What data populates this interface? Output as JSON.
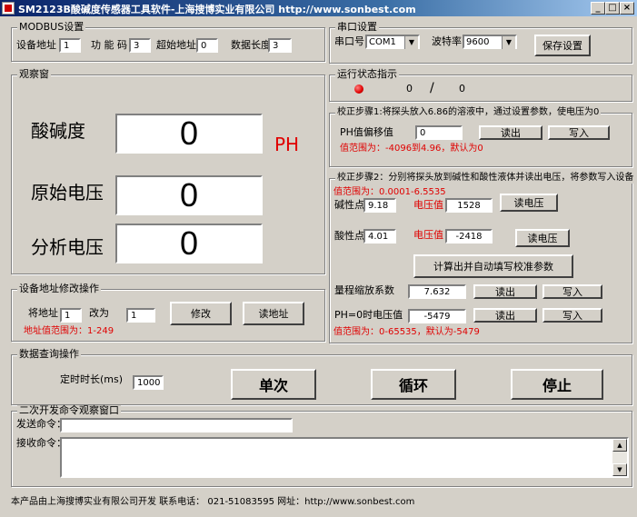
{
  "window": {
    "title": "SM2123B酸碱度传感器工具软件-上海搜博实业有限公司 http://www.sonbest.com"
  },
  "modbus": {
    "title": "MODBUS设置",
    "addr_label": "设备地址",
    "addr_value": "1",
    "func_label": "功 能 码",
    "func_value": "3",
    "start_label": "超始地址",
    "start_value": "0",
    "len_label": "数据长度",
    "len_value": "3"
  },
  "serial": {
    "title": "串口设置",
    "port_label": "串口号",
    "port_value": "COM1",
    "baud_label": "波特率",
    "baud_value": "9600",
    "save_label": "保存设置"
  },
  "status": {
    "title": "运行状态指示",
    "count_a": "0",
    "sep": "/",
    "count_b": "0"
  },
  "observe": {
    "title": "观察窗",
    "ph_label": "酸碱度",
    "ph_value": "0",
    "ph_unit": "PH",
    "raw_label": "原始电压",
    "raw_value": "0",
    "ana_label": "分析电压",
    "ana_value": "0"
  },
  "calib1": {
    "title": "校正步骤1:将探头放入6.86的溶液中，通过设置参数，使电压为0",
    "offset_label": "PH值偏移值",
    "offset_value": "0",
    "read_label": "读出",
    "write_label": "写入",
    "range_note": "值范围为：-4096到4.96，默认为0"
  },
  "calib2": {
    "title": "校正步骤2：分别将探头放到碱性和酸性液体并读出电压，将参数写入设备",
    "range_note": "值范围为：0.0001-6.5535",
    "alk_label": "碱性点",
    "alk_value": "9.18",
    "alk_volt_label": "电压值",
    "alk_volt_value": "1528",
    "alk_read": "读电压",
    "acid_label": "酸性点",
    "acid_value": "4.01",
    "acid_volt_label": "电压值",
    "acid_volt_value": "-2418",
    "acid_read": "读电压",
    "calc_label": "计算出并自动填写校准参数",
    "scale_label": "量程缩放系数",
    "scale_value": "7.632",
    "scale_read": "读出",
    "scale_write": "写入",
    "ph0_label": "PH=0时电压值",
    "ph0_value": "-5479",
    "ph0_read": "读出",
    "ph0_write": "写入",
    "ph0_note": "值范围为：0-65535，默认为-5479"
  },
  "addrmod": {
    "title": "设备地址修改操作",
    "from_label": "将地址",
    "from_value": "1",
    "to_label": "改为",
    "to_value": "1",
    "modify_label": "修改",
    "read_label": "读地址",
    "range_note": "地址值范围为：1-249"
  },
  "query": {
    "title": "数据查询操作",
    "timer_label": "定时时长(ms)",
    "timer_value": "1000",
    "once_label": "单次",
    "loop_label": "循环",
    "stop_label": "停止"
  },
  "dev": {
    "title": "二次开发命令观察窗口",
    "send_label": "发送命令：",
    "send_value": "",
    "recv_label": "接收命令："
  },
  "footer": {
    "text": "本产品由上海搜博实业有限公司开发 联系电话： 021-51083595 网址：http://www.sonbest.com"
  }
}
